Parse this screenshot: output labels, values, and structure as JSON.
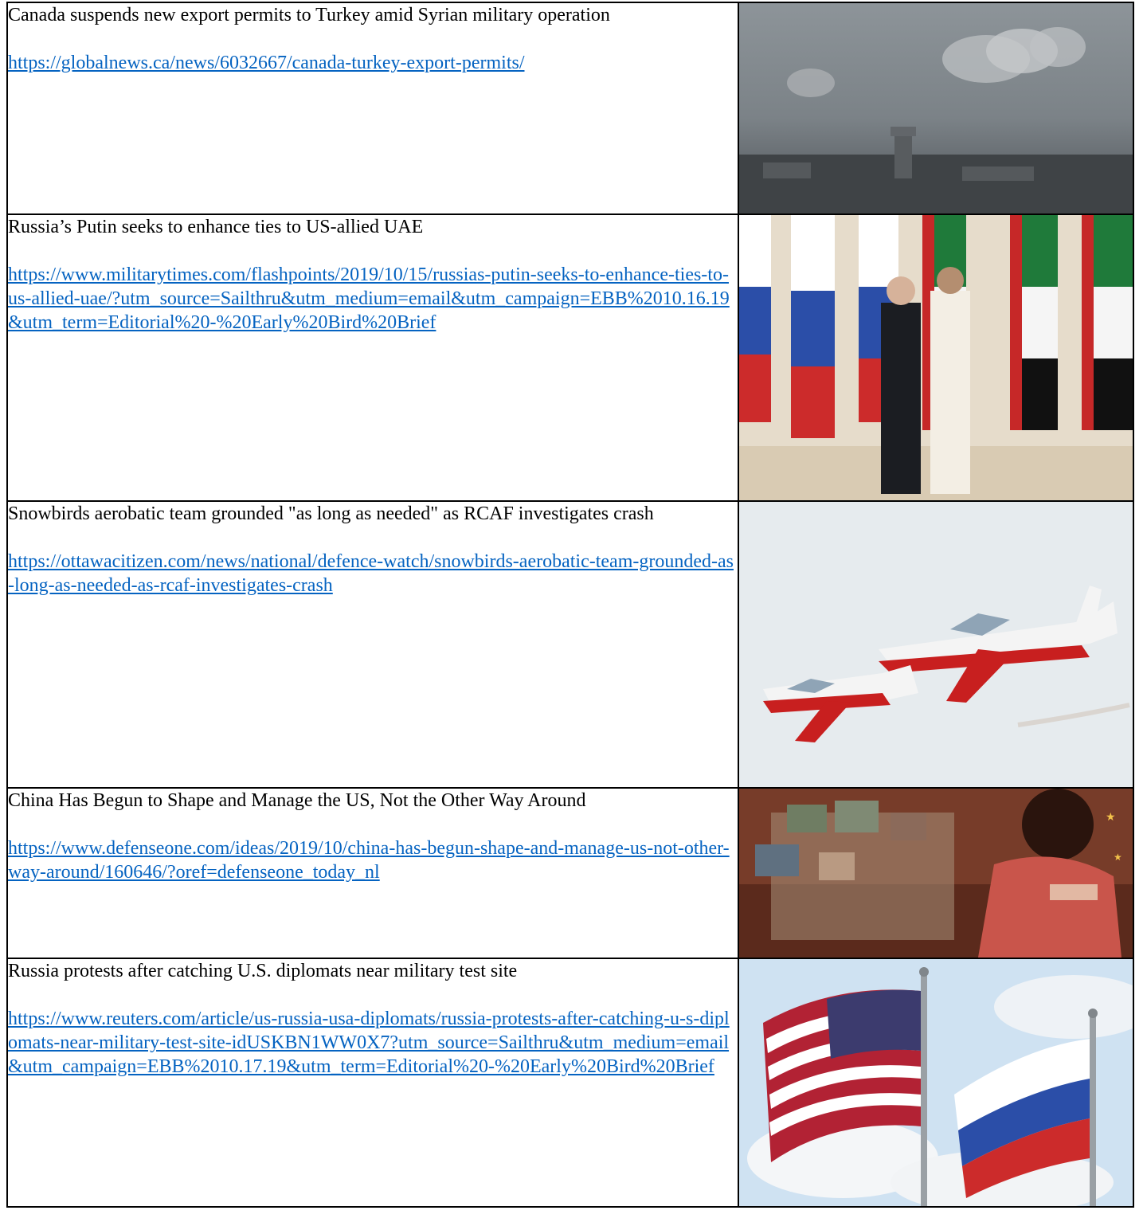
{
  "articles": [
    {
      "title": "Canada suspends new export permits to Turkey amid Syrian military operation",
      "url": "https://globalnews.ca/news/6032667/canada-turkey-export-permits/",
      "image_icon": "smoke-over-city-photo"
    },
    {
      "title": "Russia’s Putin seeks to enhance ties to US-allied UAE",
      "url": "https://www.militarytimes.com/flashpoints/2019/10/15/russias-putin-seeks-to-enhance-ties-to-us-allied-uae/?utm_source=Sailthru&utm_medium=email&utm_campaign=EBB%2010.16.19&utm_term=Editorial%20-%20Early%20Bird%20Brief",
      "image_icon": "leaders-handshake-flags-photo"
    },
    {
      "title": "Snowbirds aerobatic team grounded \"as long as needed\" as RCAF investigates crash",
      "url": "https://ottawacitizen.com/news/national/defence-watch/snowbirds-aerobatic-team-grounded-as-long-as-needed-as-rcaf-investigates-crash",
      "image_icon": "jets-in-flight-photo"
    },
    {
      "title": "China Has Begun to Shape and Manage the US, Not the Other Way Around",
      "url": "https://www.defenseone.com/ideas/2019/10/china-has-begun-shape-and-manage-us-not-other-way-around/160646/?oref=defenseone_today_nl",
      "image_icon": "animated-girl-map-photo"
    },
    {
      "title": "Russia protests after catching U.S. diplomats near military test site",
      "url": "https://www.reuters.com/article/us-russia-usa-diplomats/russia-protests-after-catching-u-s-diplomats-near-military-test-site-idUSKBN1WW0X7?utm_source=Sailthru&utm_medium=email&utm_campaign=EBB%2010.17.19&utm_term=Editorial%20-%20Early%20Bird%20Brief",
      "image_icon": "us-russia-flags-photo"
    }
  ],
  "colors": {
    "link": "#0563c1",
    "border": "#000000"
  }
}
